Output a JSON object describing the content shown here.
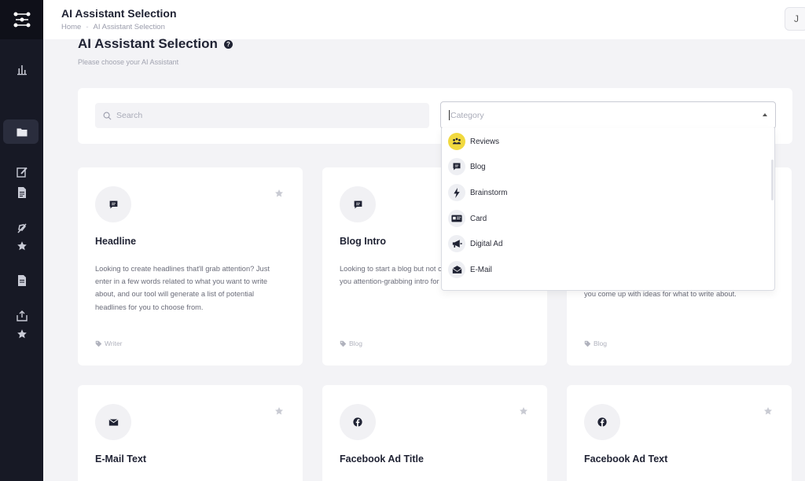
{
  "header": {
    "title": "AI Assistant Selection",
    "breadcrumbs": [
      "Home",
      "AI Assistant Selection"
    ],
    "avatar_initial": "J"
  },
  "page": {
    "title": "AI Assistant Selection",
    "subtitle": "Please choose your AI Assistant"
  },
  "search": {
    "placeholder": "Search",
    "value": ""
  },
  "category": {
    "placeholder": "Category"
  },
  "dropdown": {
    "items": [
      {
        "label": "Reviews",
        "icon": "reviews-icon",
        "highlighted": true
      },
      {
        "label": "Blog",
        "icon": "chat-icon"
      },
      {
        "label": "Brainstorm",
        "icon": "lightning-icon"
      },
      {
        "label": "Card",
        "icon": "card-icon"
      },
      {
        "label": "Digital Ad",
        "icon": "megaphone-icon"
      },
      {
        "label": "E-Mail",
        "icon": "mail-icon"
      }
    ]
  },
  "cards": [
    {
      "title": "Headline",
      "icon": "chat-icon",
      "tag": "Writer",
      "desc": "Looking to create headlines that'll grab attention? Just enter in a few words related to what you want to write about, and our tool will generate a list of potential headlines for you to choose from."
    },
    {
      "title": "Blog Intro",
      "icon": "chat-icon",
      "tag": "Blog",
      "desc": "Looking to start a blog but not our blog intro tool to help you attention-grabbing intro for your first blog post!"
    },
    {
      "title": "",
      "icon": "",
      "tag": "Blog",
      "desc": "you come up with ideas for what to write about."
    },
    {
      "title": "E-Mail Text",
      "icon": "mail-icon",
      "tag": "",
      "desc": ""
    },
    {
      "title": "Facebook Ad Title",
      "icon": "facebook-icon",
      "tag": "",
      "desc": ""
    },
    {
      "title": "Facebook Ad Text",
      "icon": "facebook-icon",
      "tag": "",
      "desc": ""
    }
  ],
  "colors": {
    "sidebar": "#171925",
    "accent_yellow": "#f1d93f",
    "background": "#f3f3f6"
  }
}
